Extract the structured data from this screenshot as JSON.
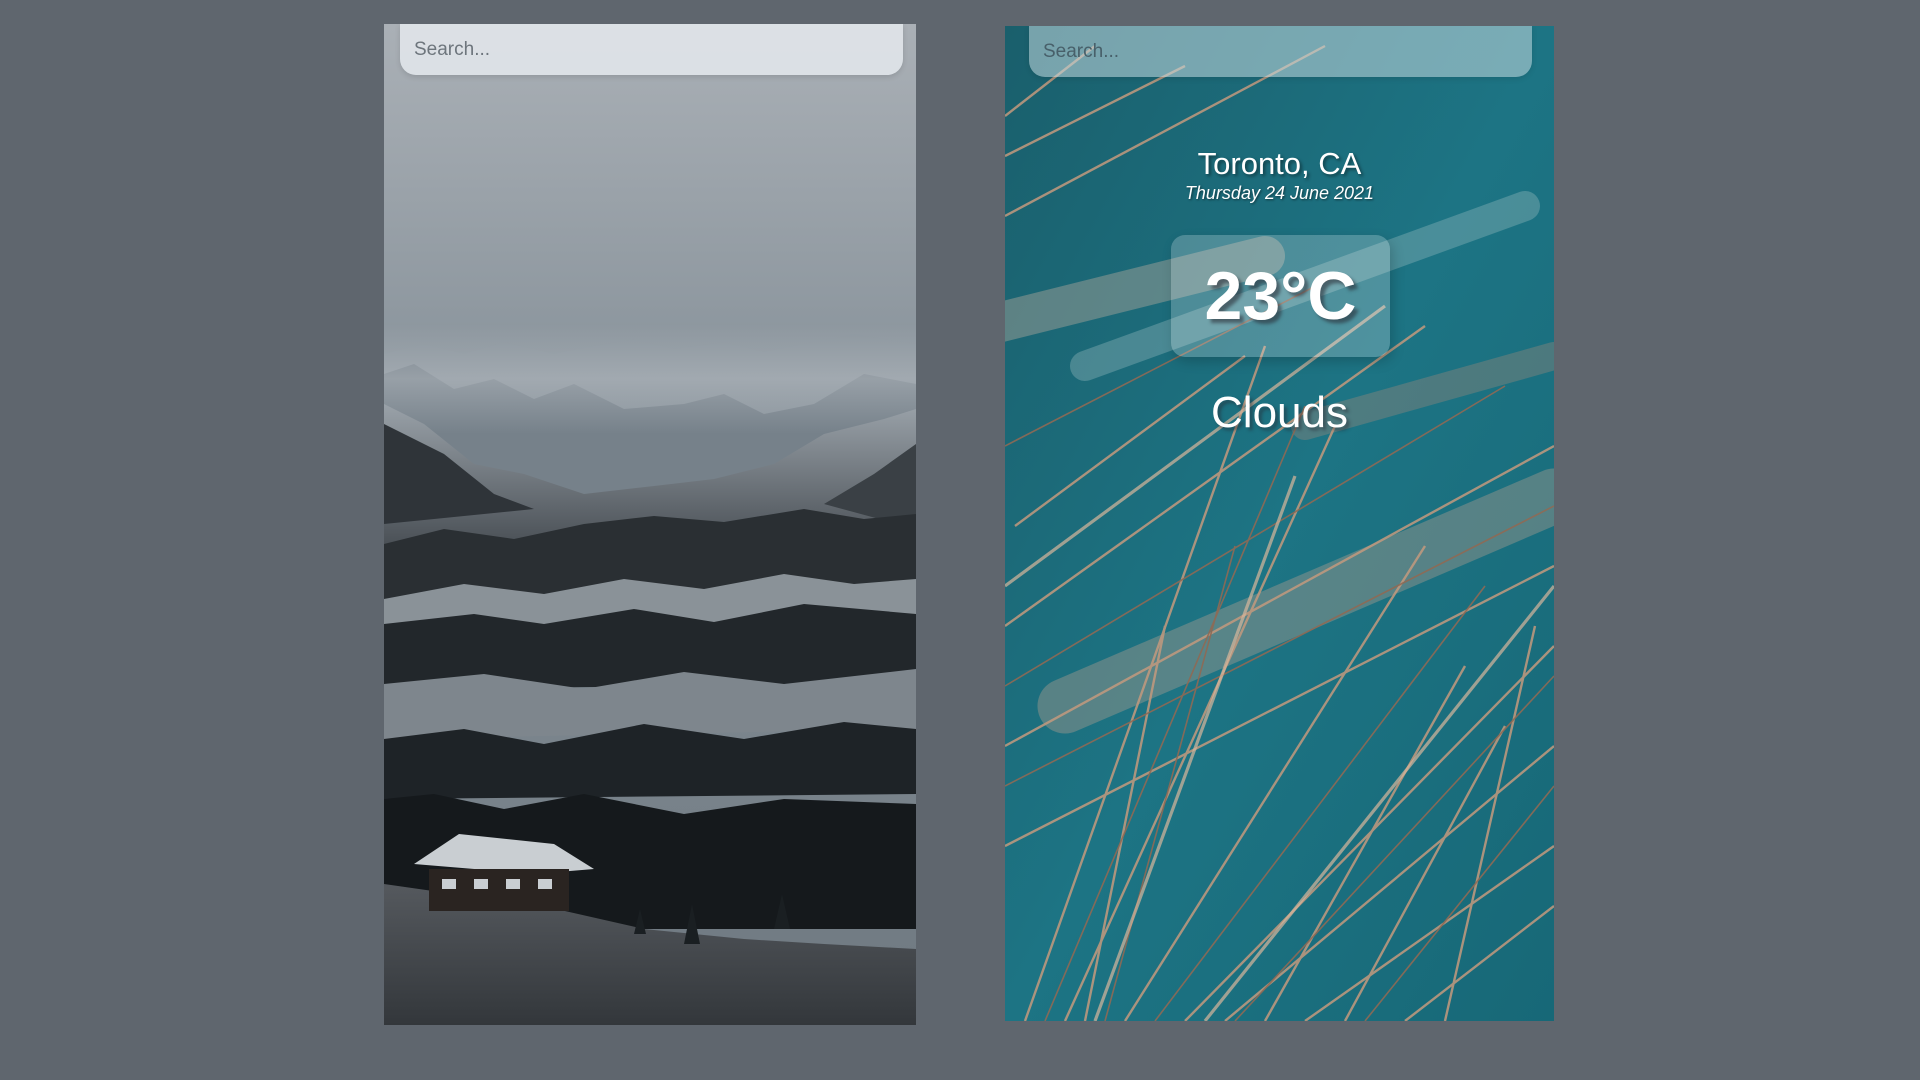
{
  "left_panel": {
    "search": {
      "placeholder": "Search..."
    }
  },
  "right_panel": {
    "search": {
      "placeholder": "Search..."
    },
    "weather": {
      "location": "Toronto, CA",
      "date": "Thursday 24 June 2021",
      "temperature": "23°C",
      "condition": "Clouds"
    }
  },
  "colors": {
    "page_background": "#5f666e",
    "left_sky": "#a7adb3",
    "right_teal": "#1a6d7c",
    "grass": "#b98b6e"
  }
}
